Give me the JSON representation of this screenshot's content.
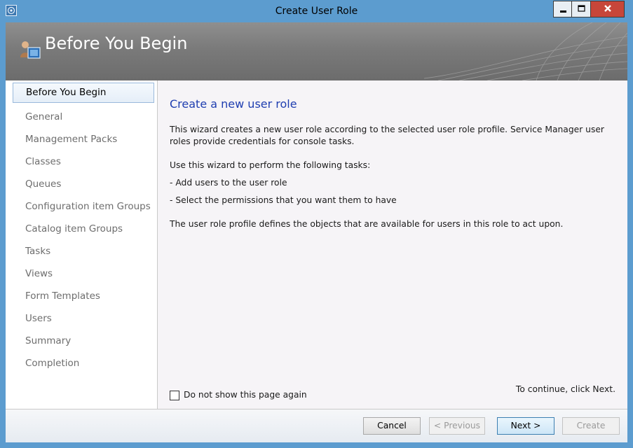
{
  "window": {
    "title": "Create User Role"
  },
  "banner": {
    "title": "Before You Begin"
  },
  "nav": {
    "items": [
      {
        "label": "Before You Begin",
        "active": true
      },
      {
        "label": "General"
      },
      {
        "label": "Management Packs"
      },
      {
        "label": "Classes"
      },
      {
        "label": "Queues"
      },
      {
        "label": "Configuration item Groups"
      },
      {
        "label": "Catalog item Groups"
      },
      {
        "label": "Tasks"
      },
      {
        "label": "Views"
      },
      {
        "label": "Form Templates"
      },
      {
        "label": "Users"
      },
      {
        "label": "Summary"
      },
      {
        "label": "Completion"
      }
    ]
  },
  "main": {
    "heading": "Create a new user role",
    "para1_line1": "This wizard creates a new user role according to the selected user role profile. Service Manager user",
    "para1_line2": "roles provide credentials for console tasks.",
    "para2": "Use this wizard to perform the following tasks:",
    "bullet1": "- Add users to the user role",
    "bullet2": "- Select the permissions that you want them to have",
    "para3": "The user role profile defines the objects that are available for users in this role to act upon.",
    "checkbox_label": "Do not show this page again",
    "checkbox_checked": false,
    "continue_hint": "To continue, click Next."
  },
  "footer": {
    "cancel_label": "Cancel",
    "previous_label": "< Previous",
    "next_label": "Next >",
    "create_label": "Create"
  },
  "colors": {
    "frame": "#5c9ccf",
    "heading": "#1f3eb0",
    "close_button": "#c7463a"
  }
}
